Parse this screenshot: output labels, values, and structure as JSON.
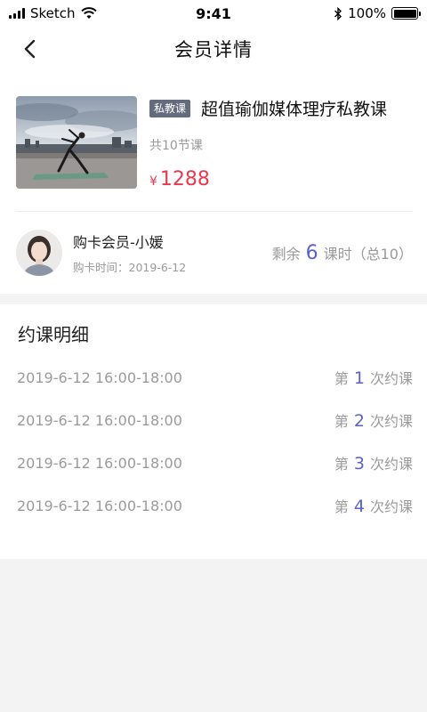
{
  "status_bar": {
    "carrier": "Sketch",
    "time": "9:41",
    "battery": "100%",
    "battery_level": 1.0
  },
  "nav": {
    "title": "会员详情",
    "back_icon": "chevron-left-icon"
  },
  "course": {
    "tag": "私教课",
    "title": "超值瑜伽媒体理疗私教课",
    "lessons": "共10节课",
    "currency": "¥",
    "price": "1288"
  },
  "member": {
    "name": "购卡会员-小媛",
    "purchase_date": "购卡时间：2019-6-12",
    "remaining_prefix": "剩余",
    "remaining_count": "6",
    "remaining_suffix": "课时（总10）"
  },
  "records": {
    "title": "约课明细",
    "prefix": "第",
    "suffix": "次约课",
    "items": [
      {
        "time": "2019-6-12 16:00-18:00",
        "n": "1"
      },
      {
        "time": "2019-6-12 16:00-18:00",
        "n": "2"
      },
      {
        "time": "2019-6-12 16:00-18:00",
        "n": "3"
      },
      {
        "time": "2019-6-12 16:00-18:00",
        "n": "4"
      }
    ]
  },
  "colors": {
    "accent": "#5b5fd0",
    "price": "#e8394f",
    "tag_bg": "#646b7d"
  }
}
